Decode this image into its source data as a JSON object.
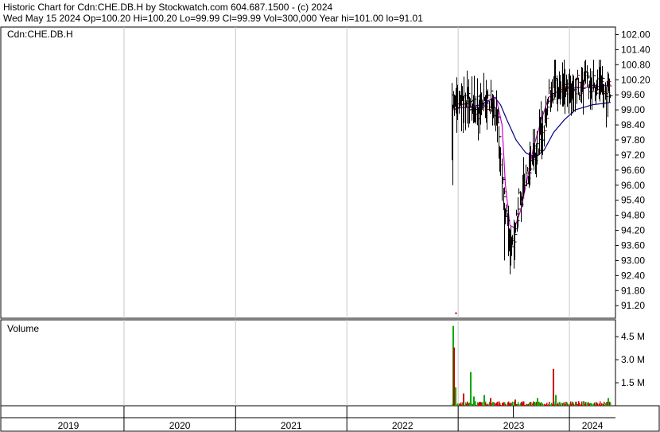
{
  "header": {
    "line1": "Historic Chart for Cdn:CHE.DB.H by Stockwatch.com 604.687.1500 - (c) 2024",
    "line2": "Wed May 15 2024   Op=100.20   Hi=100.20   Lo=99.99   Cl=99.99   Vol=300,000   Year hi=101.00   lo=91.01"
  },
  "chart_data": [
    {
      "type": "candlestick",
      "symbol_label": "Cdn:CHE.DB.H",
      "ylim": [
        90.7,
        102.3
      ],
      "y_ticks": [
        102.0,
        101.4,
        100.8,
        100.2,
        99.6,
        99.0,
        98.4,
        97.8,
        97.2,
        96.6,
        96.0,
        95.4,
        94.8,
        94.2,
        93.6,
        93.0,
        92.4,
        91.8,
        91.2
      ],
      "x_labels": [
        "2019",
        "2020",
        "2021",
        "2022",
        "2023",
        "2024"
      ],
      "colors": {
        "price": "#000000",
        "ma_short": "#cc00cc",
        "ma_long": "#000080",
        "up_tick": "#cc0000"
      },
      "outlier_point": {
        "date": "2022-12-25",
        "price": 90.9
      },
      "anchors": [
        {
          "d": "2022-12-12",
          "p": 99.2
        },
        {
          "d": "2023-01-15",
          "p": 99.3
        },
        {
          "d": "2023-02-15",
          "p": 99.2
        },
        {
          "d": "2023-03-20",
          "p": 99.0
        },
        {
          "d": "2023-04-20",
          "p": 99.5
        },
        {
          "d": "2023-05-10",
          "p": 98.8
        },
        {
          "d": "2023-05-25",
          "p": 96.0
        },
        {
          "d": "2023-06-12",
          "p": 94.2
        },
        {
          "d": "2023-06-28",
          "p": 93.8
        },
        {
          "d": "2023-07-20",
          "p": 95.4
        },
        {
          "d": "2023-08-15",
          "p": 96.6
        },
        {
          "d": "2023-09-10",
          "p": 97.4
        },
        {
          "d": "2023-10-05",
          "p": 98.2
        },
        {
          "d": "2023-10-25",
          "p": 99.6
        },
        {
          "d": "2023-11-20",
          "p": 99.9
        },
        {
          "d": "2023-12-20",
          "p": 99.7
        },
        {
          "d": "2024-01-20",
          "p": 99.9
        },
        {
          "d": "2024-02-20",
          "p": 100.1
        },
        {
          "d": "2024-03-20",
          "p": 100.0
        },
        {
          "d": "2024-04-20",
          "p": 99.8
        },
        {
          "d": "2024-05-15",
          "p": 99.99
        }
      ],
      "ma_short": [
        {
          "d": "2022-12-15",
          "p": 99.0
        },
        {
          "d": "2023-01-15",
          "p": 99.1
        },
        {
          "d": "2023-02-20",
          "p": 99.1
        },
        {
          "d": "2023-03-25",
          "p": 99.1
        },
        {
          "d": "2023-04-15",
          "p": 99.4
        },
        {
          "d": "2023-05-05",
          "p": 99.5
        },
        {
          "d": "2023-05-25",
          "p": 98.4
        },
        {
          "d": "2023-06-05",
          "p": 96.0
        },
        {
          "d": "2023-06-20",
          "p": 94.4
        },
        {
          "d": "2023-07-05",
          "p": 94.3
        },
        {
          "d": "2023-07-25",
          "p": 95.0
        },
        {
          "d": "2023-08-15",
          "p": 96.2
        },
        {
          "d": "2023-09-05",
          "p": 97.5
        },
        {
          "d": "2023-10-01",
          "p": 98.6
        },
        {
          "d": "2023-10-25",
          "p": 99.5
        },
        {
          "d": "2023-12-01",
          "p": 99.8
        },
        {
          "d": "2024-01-20",
          "p": 99.9
        },
        {
          "d": "2024-03-15",
          "p": 99.9
        },
        {
          "d": "2024-05-15",
          "p": 100.0
        }
      ],
      "ma_long": [
        {
          "d": "2023-02-01",
          "p": 99.1
        },
        {
          "d": "2023-03-15",
          "p": 99.2
        },
        {
          "d": "2023-05-01",
          "p": 99.5
        },
        {
          "d": "2023-05-20",
          "p": 99.2
        },
        {
          "d": "2023-06-10",
          "p": 98.6
        },
        {
          "d": "2023-07-10",
          "p": 97.8
        },
        {
          "d": "2023-08-10",
          "p": 97.3
        },
        {
          "d": "2023-09-10",
          "p": 97.1
        },
        {
          "d": "2023-10-10",
          "p": 97.4
        },
        {
          "d": "2023-11-10",
          "p": 98.1
        },
        {
          "d": "2023-12-15",
          "p": 98.6
        },
        {
          "d": "2024-01-20",
          "p": 99.0
        },
        {
          "d": "2024-03-15",
          "p": 99.2
        },
        {
          "d": "2024-05-15",
          "p": 99.3
        }
      ]
    },
    {
      "type": "bar",
      "title": "Volume",
      "ylim": [
        0,
        5.6
      ],
      "y_ticks_label": [
        "4.5 M",
        "3.0 M",
        "1.5 M"
      ],
      "y_ticks": [
        4.5,
        3.0,
        1.5
      ],
      "colors": {
        "up": "#00aa00",
        "down": "#cc0000"
      },
      "spikes": [
        {
          "d": "2022-12-13",
          "v": 5.2,
          "c": "up"
        },
        {
          "d": "2022-12-16",
          "v": 3.8,
          "c": "down"
        },
        {
          "d": "2022-12-22",
          "v": 1.2,
          "c": "up"
        },
        {
          "d": "2023-01-15",
          "v": 0.8,
          "c": "down"
        },
        {
          "d": "2023-02-08",
          "v": 2.2,
          "c": "up"
        },
        {
          "d": "2023-02-20",
          "v": 0.6,
          "c": "up"
        },
        {
          "d": "2023-03-25",
          "v": 0.7,
          "c": "up"
        },
        {
          "d": "2023-04-15",
          "v": 0.5,
          "c": "down"
        },
        {
          "d": "2023-07-05",
          "v": 0.4,
          "c": "down"
        },
        {
          "d": "2023-09-15",
          "v": 0.5,
          "c": "up"
        },
        {
          "d": "2023-11-08",
          "v": 2.4,
          "c": "down"
        },
        {
          "d": "2023-11-15",
          "v": 0.7,
          "c": "up"
        },
        {
          "d": "2024-02-15",
          "v": 0.3,
          "c": "up"
        },
        {
          "d": "2024-05-05",
          "v": 0.5,
          "c": "up"
        }
      ]
    }
  ]
}
